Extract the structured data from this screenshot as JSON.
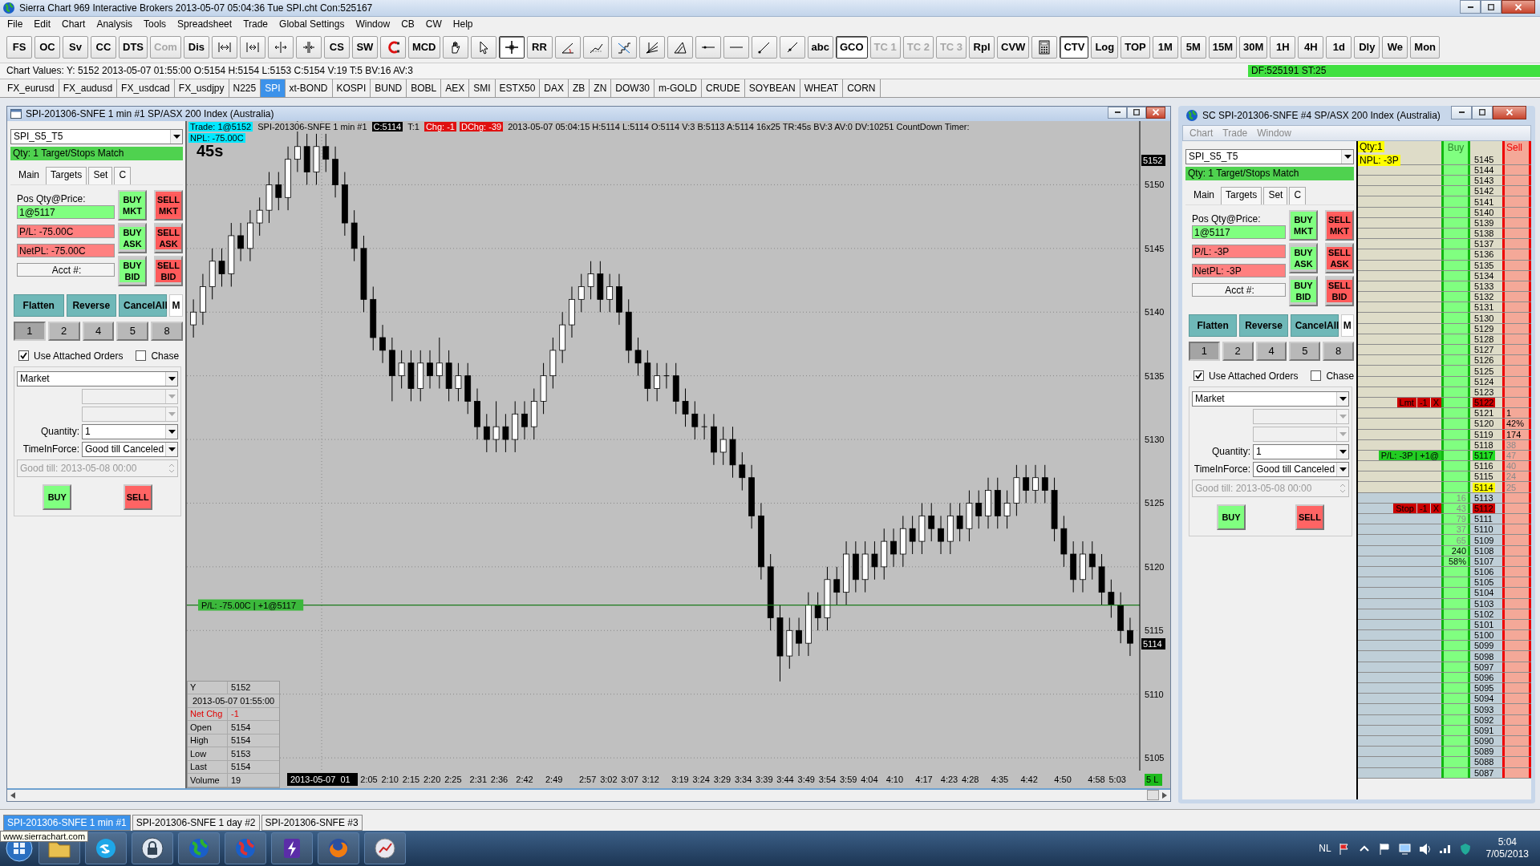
{
  "app": {
    "title": "Sierra Chart 969 Interactive Brokers 2013-05-07  05:04:36 Tue  SPI.cht Con:525167",
    "menu": [
      "File",
      "Edit",
      "Chart",
      "Analysis",
      "Tools",
      "Spreadsheet",
      "Trade",
      "Global Settings",
      "Window",
      "CB",
      "CW",
      "Help"
    ]
  },
  "toolbar": [
    {
      "kind": "button",
      "text": "FS",
      "disabled": false,
      "pressed": false
    },
    {
      "kind": "button",
      "text": "OC",
      "disabled": false,
      "pressed": false
    },
    {
      "kind": "button",
      "text": "Sv",
      "disabled": false,
      "pressed": false
    },
    {
      "kind": "button",
      "text": "CC",
      "disabled": false,
      "pressed": false
    },
    {
      "kind": "button",
      "text": "DTS",
      "disabled": false,
      "pressed": false
    },
    {
      "kind": "button",
      "text": "Com",
      "disabled": true,
      "pressed": false
    },
    {
      "kind": "button",
      "text": "Dis",
      "disabled": false,
      "pressed": false
    },
    {
      "kind": "tool",
      "pressed": false
    },
    {
      "kind": "tool",
      "pressed": false
    },
    {
      "kind": "tool",
      "pressed": false
    },
    {
      "kind": "tool",
      "pressed": false
    },
    {
      "kind": "button",
      "text": "CS",
      "disabled": false,
      "pressed": false
    },
    {
      "kind": "button",
      "text": "SW",
      "disabled": false,
      "pressed": false
    },
    {
      "kind": "tool",
      "pressed": false
    },
    {
      "kind": "button",
      "text": "MCD",
      "disabled": false,
      "pressed": false
    },
    {
      "kind": "tool",
      "pressed": false
    },
    {
      "kind": "tool",
      "pressed": false
    },
    {
      "kind": "tool",
      "pressed": true
    },
    {
      "kind": "button",
      "text": "RR",
      "disabled": false,
      "pressed": false
    },
    {
      "kind": "tool",
      "pressed": false
    },
    {
      "kind": "tool",
      "pressed": false
    },
    {
      "kind": "tool",
      "pressed": false
    },
    {
      "kind": "tool",
      "pressed": false
    },
    {
      "kind": "tool",
      "pressed": false
    },
    {
      "kind": "tool",
      "pressed": false
    },
    {
      "kind": "tool",
      "pressed": false
    },
    {
      "kind": "tool",
      "pressed": false
    },
    {
      "kind": "tool",
      "pressed": false
    },
    {
      "kind": "button",
      "text": "abc",
      "disabled": false,
      "pressed": false
    },
    {
      "kind": "button",
      "text": "GCO",
      "disabled": false,
      "pressed": true
    },
    {
      "kind": "button",
      "text": "TC 1",
      "disabled": true,
      "pressed": false
    },
    {
      "kind": "button",
      "text": "TC 2",
      "disabled": true,
      "pressed": false
    },
    {
      "kind": "button",
      "text": "TC 3",
      "disabled": true,
      "pressed": false
    },
    {
      "kind": "button",
      "text": "Rpl",
      "disabled": false,
      "pressed": false
    },
    {
      "kind": "button",
      "text": "CVW",
      "disabled": false,
      "pressed": false
    },
    {
      "kind": "tool",
      "pressed": false
    },
    {
      "kind": "button",
      "text": "CTV",
      "disabled": false,
      "pressed": true
    },
    {
      "kind": "button",
      "text": "Log",
      "disabled": false,
      "pressed": false
    },
    {
      "kind": "button",
      "text": "TOP",
      "disabled": false,
      "pressed": false
    },
    {
      "kind": "button",
      "text": "1M",
      "disabled": false,
      "pressed": false
    },
    {
      "kind": "button",
      "text": "5M",
      "disabled": false,
      "pressed": false
    },
    {
      "kind": "button",
      "text": "15M",
      "disabled": false,
      "pressed": false
    },
    {
      "kind": "button",
      "text": "30M",
      "disabled": false,
      "pressed": false
    },
    {
      "kind": "button",
      "text": "1H",
      "disabled": false,
      "pressed": false
    },
    {
      "kind": "button",
      "text": "4H",
      "disabled": false,
      "pressed": false
    },
    {
      "kind": "button",
      "text": "1d",
      "disabled": false,
      "pressed": false
    },
    {
      "kind": "button",
      "text": "Dly",
      "disabled": false,
      "pressed": false
    },
    {
      "kind": "button",
      "text": "We",
      "disabled": false,
      "pressed": false
    },
    {
      "kind": "button",
      "text": "Mon",
      "disabled": false,
      "pressed": false
    }
  ],
  "chart_values": {
    "text": "Chart Values: Y: 5152  2013-05-07 01:55:00  O:5154  H:5154  L:5153  C:5154  V:19  T:5  BV:16  AV:3",
    "feed": "DF:525191  ST:25"
  },
  "symbols": [
    {
      "label": "FX_eurusd",
      "selected": false
    },
    {
      "label": "FX_audusd",
      "selected": false
    },
    {
      "label": "FX_usdcad",
      "selected": false
    },
    {
      "label": "FX_usdjpy",
      "selected": false
    },
    {
      "label": "N225",
      "selected": false
    },
    {
      "label": "SPI",
      "selected": true
    },
    {
      "label": "xt-BOND",
      "selected": false
    },
    {
      "label": "KOSPI",
      "selected": false
    },
    {
      "label": "BUND",
      "selected": false
    },
    {
      "label": "BOBL",
      "selected": false
    },
    {
      "label": "AEX",
      "selected": false
    },
    {
      "label": "SMI",
      "selected": false
    },
    {
      "label": "ESTX50",
      "selected": false
    },
    {
      "label": "DAX",
      "selected": false
    },
    {
      "label": "ZB",
      "selected": false
    },
    {
      "label": "ZN",
      "selected": false
    },
    {
      "label": "DOW30",
      "selected": false
    },
    {
      "label": "m-GOLD",
      "selected": false
    },
    {
      "label": "CRUDE",
      "selected": false
    },
    {
      "label": "SOYBEAN",
      "selected": false
    },
    {
      "label": "WHEAT",
      "selected": false
    },
    {
      "label": "CORN",
      "selected": false
    }
  ],
  "chart_window": {
    "title": "SPI-201306-SNFE  1 min   #1  SP/ASX 200 Index (Australia)",
    "panel": {
      "account_set": "SPI_S5_T5",
      "status": "Qty: 1 Target/Stops Match",
      "tabs": [
        {
          "label": "Main",
          "selected": true
        },
        {
          "label": "Targets",
          "selected": false
        },
        {
          "label": "Set",
          "selected": false
        },
        {
          "label": "C",
          "selected": false
        }
      ],
      "pos_label": "Pos Qty@Price:",
      "fields": [
        {
          "text": "1@5117",
          "kind": "gain"
        },
        {
          "text": "P/L: -75.00C",
          "kind": "loss"
        },
        {
          "text": "NetPL: -75.00C",
          "kind": "loss"
        },
        {
          "text": "Acct #:",
          "kind": "neutral"
        }
      ],
      "order_buttons": [
        {
          "text": "BUY MKT",
          "kind": "buy_market"
        },
        {
          "text": "SELL MKT",
          "kind": "sell_market"
        },
        {
          "text": "BUY ASK",
          "kind": "buy_limit"
        },
        {
          "text": "SELL ASK",
          "kind": "sell_limit"
        },
        {
          "text": "BUY BID",
          "kind": "buy_limit"
        },
        {
          "text": "SELL BID",
          "kind": "sell_limit"
        }
      ],
      "actions": [
        "Flatten",
        "Reverse",
        "CancelAll",
        "M"
      ],
      "qty_presets": [
        {
          "text": "1",
          "selected": true
        },
        {
          "text": "2",
          "selected": false
        },
        {
          "text": "4",
          "selected": false
        },
        {
          "text": "5",
          "selected": false
        },
        {
          "text": "8",
          "selected": false
        }
      ],
      "options": [
        {
          "label": "Use Attached Orders",
          "checked": true
        },
        {
          "label": "Chase",
          "checked": false
        }
      ],
      "order_type": "Market",
      "quantity_label": "Quantity:",
      "quantity": "1",
      "tif_label": "TimeInForce:",
      "tif": "Good till Canceled",
      "good_till": "Good till: 2013-05-08 00:00",
      "submit": [
        {
          "text": "BUY",
          "kind": "buy"
        },
        {
          "text": "SELL",
          "kind": "sell"
        }
      ]
    },
    "chart": {
      "header": [
        {
          "text": "Trade: 1@5152",
          "kind": "highlight"
        },
        {
          "text": "SPI-201306-SNFE  1 min   #1",
          "kind": "plain"
        },
        {
          "text": "C:5114",
          "kind": "inverse"
        },
        {
          "text": "T:1",
          "kind": "plain"
        },
        {
          "text": "Chg: -1",
          "kind": "alert"
        },
        {
          "text": "DChg: -39",
          "kind": "alert"
        },
        {
          "text": "2013-05-07 05:04:15 H:5114 L:5114 O:5114 V:3 B:5113 A:5114 16x25 TR:45s BV:3 AV:0 DV:10251  CountDown Timer:",
          "kind": "plain"
        }
      ],
      "npl": "NPL: -75.00C",
      "timer": "45s",
      "price_markers": [
        "5152",
        "5114"
      ],
      "chart_data": {
        "type": "candlestick",
        "grid": true,
        "xlim": [
          81.7,
          308.3
        ],
        "ylim": [
          5104,
          5155
        ],
        "xticks": [
          {
            "value": 125,
            "label": "2:05"
          },
          {
            "value": 130,
            "label": "2:10"
          },
          {
            "value": 135,
            "label": "2:15"
          },
          {
            "value": 140,
            "label": "2:20"
          },
          {
            "value": 145,
            "label": "2:25"
          },
          {
            "value": 151,
            "label": "2:31"
          },
          {
            "value": 156,
            "label": "2:36"
          },
          {
            "value": 162,
            "label": "2:42"
          },
          {
            "value": 169,
            "label": "2:49"
          },
          {
            "value": 177,
            "label": "2:57"
          },
          {
            "value": 182,
            "label": "3:02"
          },
          {
            "value": 187,
            "label": "3:07"
          },
          {
            "value": 192,
            "label": "3:12"
          },
          {
            "value": 199,
            "label": "3:19"
          },
          {
            "value": 204,
            "label": "3:24"
          },
          {
            "value": 209,
            "label": "3:29"
          },
          {
            "value": 214,
            "label": "3:34"
          },
          {
            "value": 219,
            "label": "3:39"
          },
          {
            "value": 224,
            "label": "3:44"
          },
          {
            "value": 229,
            "label": "3:49"
          },
          {
            "value": 234,
            "label": "3:54"
          },
          {
            "value": 239,
            "label": "3:59"
          },
          {
            "value": 244,
            "label": "4:04"
          },
          {
            "value": 250,
            "label": "4:10"
          },
          {
            "value": 257,
            "label": "4:17"
          },
          {
            "value": 263,
            "label": "4:23"
          },
          {
            "value": 268,
            "label": "4:28"
          },
          {
            "value": 275,
            "label": "4:35"
          },
          {
            "value": 282,
            "label": "4:42"
          },
          {
            "value": 290,
            "label": "4:50"
          },
          {
            "value": 298,
            "label": "4:58"
          },
          {
            "value": 303,
            "label": "5:03"
          }
        ],
        "ref_lines": [
          {
            "axis": "y",
            "value": 5117,
            "label": "P/L: -75.00C | +1@5117"
          }
        ],
        "yticks": [
          5150,
          5145,
          5140,
          5135,
          5130,
          5125,
          5120,
          5115,
          5110,
          5105
        ],
        "x": [
          83.25,
          85.5,
          87.75,
          90,
          92.25,
          94.5,
          96.75,
          99,
          101.25,
          103.5,
          105.75,
          108,
          110.25,
          112.5,
          114.75,
          117,
          119.25,
          121.5,
          123.75,
          126,
          128.25,
          130.5,
          132.75,
          135,
          137.25,
          139.5,
          141.75,
          144,
          146.25,
          148.5,
          150.75,
          153,
          155.25,
          157.5,
          159.75,
          162,
          164.25,
          166.5,
          168.75,
          171,
          173.25,
          175.5,
          177.75,
          180,
          182.25,
          184.5,
          186.75,
          189,
          191.25,
          193.5,
          195.75,
          198,
          200.25,
          202.5,
          204.75,
          207,
          209.25,
          211.5,
          213.75,
          216,
          218.25,
          220.5,
          222.75,
          225,
          227.25,
          229.5,
          231.75,
          234,
          236.25,
          238.5,
          240.75,
          243,
          245.25,
          247.5,
          249.75,
          252,
          254.25,
          256.5,
          258.75,
          261,
          263.25,
          265.5,
          267.75,
          270,
          272.25,
          274.5,
          276.75,
          279,
          281.25,
          283.5,
          285.75,
          288,
          290.25,
          292.5,
          294.75,
          297,
          299.25,
          301.5,
          303.75,
          306
        ],
        "ohlc": [
          [
            5139,
            5141,
            5138,
            5140
          ],
          [
            5140,
            5143,
            5139,
            5142
          ],
          [
            5142,
            5145,
            5141,
            5144
          ],
          [
            5144,
            5145,
            5142,
            5143
          ],
          [
            5143,
            5147,
            5142,
            5146
          ],
          [
            5146,
            5147,
            5144,
            5145
          ],
          [
            5145,
            5148,
            5144,
            5147
          ],
          [
            5147,
            5149,
            5146,
            5148
          ],
          [
            5148,
            5151,
            5147,
            5150
          ],
          [
            5150,
            5151,
            5148,
            5149
          ],
          [
            5149,
            5153,
            5148,
            5152
          ],
          [
            5152,
            5155,
            5151,
            5153
          ],
          [
            5153,
            5154,
            5150,
            5151
          ],
          [
            5151,
            5154,
            5150,
            5153
          ],
          [
            5153,
            5154,
            5151,
            5152
          ],
          [
            5152,
            5153,
            5149,
            5150
          ],
          [
            5150,
            5151,
            5146,
            5147
          ],
          [
            5147,
            5148,
            5144,
            5145
          ],
          [
            5145,
            5146,
            5140,
            5141
          ],
          [
            5141,
            5142,
            5137,
            5138
          ],
          [
            5138,
            5139,
            5136,
            5137
          ],
          [
            5137,
            5138,
            5133,
            5135
          ],
          [
            5135,
            5137,
            5134,
            5136
          ],
          [
            5136,
            5137,
            5133,
            5134
          ],
          [
            5134,
            5137,
            5133,
            5136
          ],
          [
            5136,
            5137,
            5134,
            5135
          ],
          [
            5135,
            5138,
            5134,
            5136
          ],
          [
            5136,
            5137,
            5133,
            5134
          ],
          [
            5134,
            5136,
            5133,
            5135
          ],
          [
            5135,
            5136,
            5132,
            5133
          ],
          [
            5133,
            5134,
            5130,
            5131
          ],
          [
            5131,
            5132,
            5129,
            5130
          ],
          [
            5130,
            5133,
            5129,
            5131
          ],
          [
            5131,
            5132,
            5129,
            5130
          ],
          [
            5130,
            5133,
            5129,
            5132
          ],
          [
            5132,
            5133,
            5130,
            5131
          ],
          [
            5131,
            5134,
            5130,
            5133
          ],
          [
            5133,
            5136,
            5132,
            5135
          ],
          [
            5135,
            5138,
            5134,
            5137
          ],
          [
            5137,
            5140,
            5136,
            5139
          ],
          [
            5139,
            5142,
            5138,
            5141
          ],
          [
            5141,
            5143,
            5140,
            5142
          ],
          [
            5142,
            5144,
            5141,
            5143
          ],
          [
            5143,
            5144,
            5140,
            5141
          ],
          [
            5141,
            5143,
            5140,
            5142
          ],
          [
            5142,
            5143,
            5139,
            5140
          ],
          [
            5140,
            5141,
            5136,
            5137
          ],
          [
            5137,
            5138,
            5135,
            5136
          ],
          [
            5136,
            5137,
            5133,
            5134
          ],
          [
            5134,
            5136,
            5133,
            5135
          ],
          [
            5135,
            5136,
            5134,
            5135
          ],
          [
            5135,
            5136,
            5132,
            5133
          ],
          [
            5133,
            5134,
            5131,
            5132
          ],
          [
            5132,
            5133,
            5130,
            5131
          ],
          [
            5131,
            5132,
            5130,
            5131
          ],
          [
            5131,
            5132,
            5128,
            5129
          ],
          [
            5129,
            5131,
            5128,
            5130
          ],
          [
            5130,
            5131,
            5127,
            5128
          ],
          [
            5128,
            5129,
            5126,
            5127
          ],
          [
            5127,
            5128,
            5123,
            5124
          ],
          [
            5124,
            5125,
            5119,
            5120
          ],
          [
            5120,
            5121,
            5115,
            5116
          ],
          [
            5116,
            5117,
            5111,
            5113
          ],
          [
            5113,
            5116,
            5112,
            5115
          ],
          [
            5115,
            5116,
            5113,
            5114
          ],
          [
            5114,
            5118,
            5113,
            5117
          ],
          [
            5117,
            5118,
            5115,
            5116
          ],
          [
            5116,
            5120,
            5115,
            5119
          ],
          [
            5119,
            5120,
            5117,
            5118
          ],
          [
            5118,
            5122,
            5117,
            5121
          ],
          [
            5121,
            5122,
            5118,
            5119
          ],
          [
            5119,
            5122,
            5118,
            5121
          ],
          [
            5121,
            5122,
            5119,
            5120
          ],
          [
            5120,
            5123,
            5119,
            5122
          ],
          [
            5122,
            5123,
            5120,
            5121
          ],
          [
            5121,
            5124,
            5120,
            5123
          ],
          [
            5123,
            5124,
            5121,
            5122
          ],
          [
            5122,
            5125,
            5121,
            5124
          ],
          [
            5124,
            5125,
            5122,
            5123
          ],
          [
            5123,
            5124,
            5121,
            5122
          ],
          [
            5122,
            5125,
            5121,
            5124
          ],
          [
            5124,
            5125,
            5122,
            5123
          ],
          [
            5123,
            5126,
            5122,
            5125
          ],
          [
            5125,
            5126,
            5123,
            5124
          ],
          [
            5124,
            5127,
            5123,
            5126
          ],
          [
            5126,
            5127,
            5123,
            5124
          ],
          [
            5124,
            5126,
            5123,
            5125
          ],
          [
            5125,
            5128,
            5124,
            5127
          ],
          [
            5127,
            5128,
            5125,
            5126
          ],
          [
            5126,
            5128,
            5125,
            5127
          ],
          [
            5127,
            5128,
            5125,
            5126
          ],
          [
            5126,
            5127,
            5122,
            5123
          ],
          [
            5123,
            5124,
            5120,
            5121
          ],
          [
            5121,
            5122,
            5118,
            5119
          ],
          [
            5119,
            5122,
            5118,
            5121
          ],
          [
            5121,
            5122,
            5119,
            5120
          ],
          [
            5120,
            5121,
            5117,
            5118
          ],
          [
            5118,
            5119,
            5116,
            5117
          ],
          [
            5117,
            5118,
            5114,
            5115
          ],
          [
            5115,
            5116,
            5113,
            5114
          ]
        ]
      },
      "time_start": "2013-05-07  01",
      "period_badge": "5 L",
      "data_window": [
        {
          "label": "Y",
          "value": "5152",
          "kind": "plain"
        },
        {
          "label": "2013-05-07  01:55:00",
          "kind": "date"
        },
        {
          "label": "Net Chg",
          "value": "-1",
          "kind": "change"
        },
        {
          "label": "Open",
          "value": "5154",
          "kind": "plain"
        },
        {
          "label": "High",
          "value": "5154",
          "kind": "plain"
        },
        {
          "label": "Low",
          "value": "5153",
          "kind": "plain"
        },
        {
          "label": "Last",
          "value": "5154",
          "kind": "plain"
        },
        {
          "label": "Volume",
          "value": "19",
          "kind": "plain"
        }
      ]
    }
  },
  "dom_window": {
    "title": "SC SPI-201306-SNFE  #4  SP/ASX 200 Index (Australia)",
    "menu": [
      "Chart",
      "Trade",
      "Window"
    ],
    "panel": {
      "account_set": "SPI_S5_T5",
      "status": "Qty: 1 Target/Stops Match",
      "tabs": [
        {
          "label": "Main",
          "selected": true
        },
        {
          "label": "Targets",
          "selected": false
        },
        {
          "label": "Set",
          "selected": false
        },
        {
          "label": "C",
          "selected": false
        }
      ],
      "pos_label": "Pos Qty@Price:",
      "fields": [
        {
          "text": "1@5117",
          "kind": "gain"
        },
        {
          "text": "P/L: -3P",
          "kind": "loss"
        },
        {
          "text": "NetPL: -3P",
          "kind": "loss"
        },
        {
          "text": "Acct #:",
          "kind": "neutral"
        }
      ],
      "order_buttons": [
        {
          "text": "BUY MKT",
          "kind": "buy_market"
        },
        {
          "text": "SELL MKT",
          "kind": "sell_market"
        },
        {
          "text": "BUY ASK",
          "kind": "buy_limit"
        },
        {
          "text": "SELL ASK",
          "kind": "sell_limit"
        },
        {
          "text": "BUY BID",
          "kind": "buy_limit"
        },
        {
          "text": "SELL BID",
          "kind": "sell_limit"
        }
      ],
      "actions": [
        "Flatten",
        "Reverse",
        "CancelAll",
        "M"
      ],
      "qty_presets": [
        {
          "text": "1",
          "selected": true
        },
        {
          "text": "2",
          "selected": false
        },
        {
          "text": "4",
          "selected": false
        },
        {
          "text": "5",
          "selected": false
        },
        {
          "text": "8",
          "selected": false
        }
      ],
      "options": [
        {
          "label": "Use Attached Orders",
          "checked": true
        },
        {
          "label": "Chase",
          "checked": false
        }
      ],
      "order_type": "Market",
      "quantity_label": "Quantity:",
      "quantity": "1",
      "tif_label": "TimeInForce:",
      "tif": "Good till Canceled",
      "good_till": "Good till: 2013-05-08 00:00",
      "submit": [
        {
          "text": "BUY",
          "kind": "buy"
        },
        {
          "text": "SELL",
          "kind": "sell"
        }
      ]
    },
    "ladder": {
      "qty": "Qty:1",
      "npl": "NPL: -3P",
      "buy_header": "Buy",
      "sell_header": "Sell",
      "rows": [
        {
          "price": "5145",
          "kind": "ask"
        },
        {
          "price": "5144",
          "kind": "ask"
        },
        {
          "price": "5143",
          "kind": "ask"
        },
        {
          "price": "5142",
          "kind": "ask"
        },
        {
          "price": "5141",
          "kind": "ask"
        },
        {
          "price": "5140",
          "kind": "ask"
        },
        {
          "price": "5139",
          "kind": "ask"
        },
        {
          "price": "5138",
          "kind": "ask"
        },
        {
          "price": "5137",
          "kind": "ask"
        },
        {
          "price": "5136",
          "kind": "ask"
        },
        {
          "price": "5135",
          "kind": "ask"
        },
        {
          "price": "5134",
          "kind": "ask"
        },
        {
          "price": "5133",
          "kind": "ask"
        },
        {
          "price": "5132",
          "kind": "ask"
        },
        {
          "price": "5131",
          "kind": "ask"
        },
        {
          "price": "5130",
          "kind": "ask"
        },
        {
          "price": "5129",
          "kind": "ask"
        },
        {
          "price": "5128",
          "kind": "ask"
        },
        {
          "price": "5127",
          "kind": "ask"
        },
        {
          "price": "5126",
          "kind": "ask"
        },
        {
          "price": "5125",
          "kind": "ask"
        },
        {
          "price": "5124",
          "kind": "ask"
        },
        {
          "price": "5123",
          "kind": "ask"
        },
        {
          "price": "5122",
          "kind": "ask",
          "color": "#d00000",
          "orders": [
            {
              "text": "Lmt",
              "kind": "order"
            },
            {
              "text": "-1",
              "kind": "order"
            },
            {
              "text": "X",
              "kind": "cancel"
            }
          ]
        },
        {
          "price": "5121",
          "kind": "ask",
          "sell": {
            "text": "1",
            "dim": false
          }
        },
        {
          "price": "5120",
          "kind": "ask",
          "sell": {
            "text": "42%",
            "dim": false
          }
        },
        {
          "price": "5119",
          "kind": "ask",
          "sell": {
            "text": "174",
            "dim": false
          }
        },
        {
          "price": "5118",
          "kind": "ask",
          "sell": {
            "text": "38",
            "dim": true
          }
        },
        {
          "price": "5117",
          "kind": "ask",
          "color": "#22dd22",
          "sell": {
            "text": "47",
            "dim": true
          },
          "orders": [
            {
              "text": "P/L: -3P | +1@",
              "kind": "position"
            }
          ]
        },
        {
          "price": "5116",
          "kind": "ask",
          "sell": {
            "text": "40",
            "dim": true
          }
        },
        {
          "price": "5115",
          "kind": "ask",
          "sell": {
            "text": "24",
            "dim": true
          }
        },
        {
          "price": "5114",
          "kind": "ask",
          "color": "#ffff00",
          "sell": {
            "text": "25",
            "dim": true
          }
        },
        {
          "price": "5113",
          "kind": "bid",
          "buy": {
            "text": "16",
            "dim": true
          }
        },
        {
          "price": "5112",
          "kind": "bid",
          "color": "#d00000",
          "buy": {
            "text": "43",
            "dim": true
          },
          "orders": [
            {
              "text": "Stop",
              "kind": "order"
            },
            {
              "text": "-1",
              "kind": "order"
            },
            {
              "text": "X",
              "kind": "cancel"
            }
          ]
        },
        {
          "price": "5111",
          "kind": "bid",
          "buy": {
            "text": "79",
            "dim": true
          }
        },
        {
          "price": "5110",
          "kind": "bid",
          "buy": {
            "text": "37",
            "dim": true
          }
        },
        {
          "price": "5109",
          "kind": "bid",
          "buy": {
            "text": "65",
            "dim": true
          }
        },
        {
          "price": "5108",
          "kind": "bid",
          "buy": {
            "text": "240",
            "dim": false
          }
        },
        {
          "price": "5107",
          "kind": "bid",
          "buy": {
            "text": "58%",
            "dim": false
          }
        },
        {
          "price": "5106",
          "kind": "bid"
        },
        {
          "price": "5105",
          "kind": "bid"
        },
        {
          "price": "5104",
          "kind": "bid"
        },
        {
          "price": "5103",
          "kind": "bid"
        },
        {
          "price": "5102",
          "kind": "bid"
        },
        {
          "price": "5101",
          "kind": "bid"
        },
        {
          "price": "5100",
          "kind": "bid"
        },
        {
          "price": "5099",
          "kind": "bid"
        },
        {
          "price": "5098",
          "kind": "bid"
        },
        {
          "price": "5097",
          "kind": "bid"
        },
        {
          "price": "5096",
          "kind": "bid"
        },
        {
          "price": "5095",
          "kind": "bid"
        },
        {
          "price": "5094",
          "kind": "bid"
        },
        {
          "price": "5093",
          "kind": "bid"
        },
        {
          "price": "5092",
          "kind": "bid"
        },
        {
          "price": "5091",
          "kind": "bid"
        },
        {
          "price": "5090",
          "kind": "bid"
        },
        {
          "price": "5089",
          "kind": "bid"
        },
        {
          "price": "5088",
          "kind": "bid"
        },
        {
          "price": "5087",
          "kind": "bid"
        }
      ]
    }
  },
  "chart_tabs": [
    {
      "label": "SPI-201306-SNFE  1 min  #1",
      "selected": true
    },
    {
      "label": "SPI-201306-SNFE  1 day  #2",
      "selected": false
    },
    {
      "label": "SPI-201306-SNFE  #3",
      "selected": false
    }
  ],
  "taskbar": {
    "tooltip": "www.sierrachart.com",
    "language": "NL",
    "time": "5:04",
    "date": "7/05/2013"
  }
}
